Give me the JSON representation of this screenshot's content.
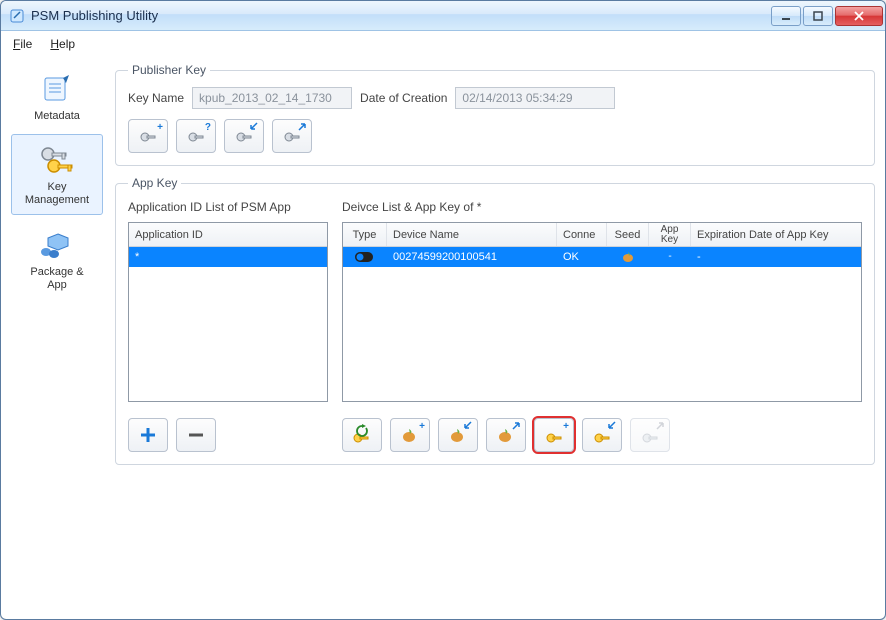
{
  "window": {
    "title": "PSM Publishing Utility"
  },
  "menu": {
    "file": "File",
    "help": "Help"
  },
  "sidebar": {
    "items": [
      {
        "label": "Metadata"
      },
      {
        "label": "Key\nManagement"
      },
      {
        "label": "Package &\nApp"
      }
    ],
    "selected_index": 1
  },
  "publisher_key": {
    "legend": "Publisher Key",
    "key_name_label": "Key Name",
    "key_name_value": "kpub_2013_02_14_1730",
    "date_label": "Date of Creation",
    "date_value": "02/14/2013 05:34:29"
  },
  "app_key": {
    "legend": "App Key",
    "appid_list_label": "Application ID List of PSM App",
    "appid_header": "Application ID",
    "appid_rows": [
      {
        "id": "*"
      }
    ],
    "device_list_label": "Deivce List & App Key of *",
    "device_headers": {
      "type": "Type",
      "name": "Device Name",
      "conn": "Conne",
      "seed": "Seed",
      "key": "App Key",
      "exp": "Expiration Date of App Key"
    },
    "device_rows": [
      {
        "name": "00274599200100541",
        "conn": "OK",
        "key": "-",
        "exp": "-"
      }
    ]
  },
  "colors": {
    "selection": "#0a84ff",
    "accent": "#e03030"
  }
}
